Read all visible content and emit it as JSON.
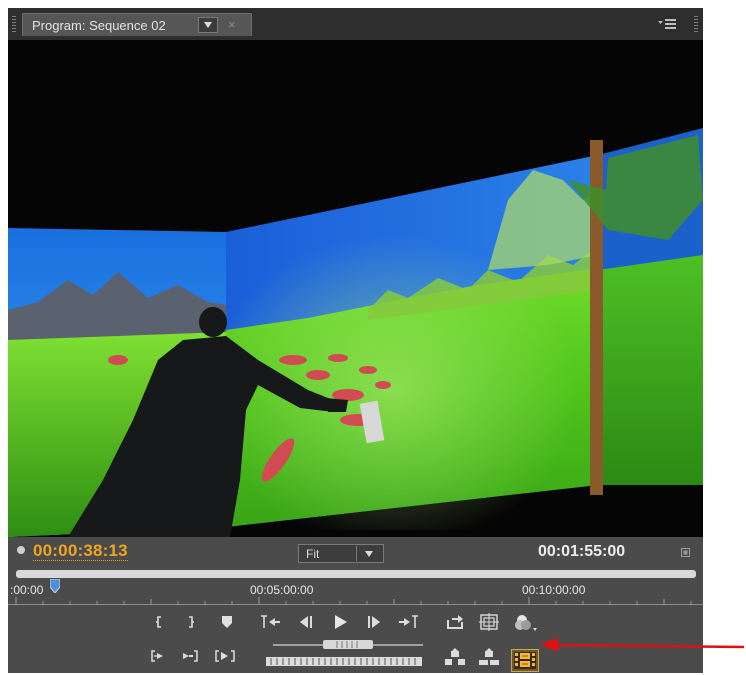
{
  "panel": {
    "tab_title": "Program: Sequence 02",
    "close_glyph": "×"
  },
  "timecode": {
    "current": "00:00:38:13",
    "duration": "00:01:55:00"
  },
  "zoom": {
    "selected": "Fit"
  },
  "ruler": {
    "labels": [
      ":00:00",
      "00:05:00:00",
      "00:10:00:00"
    ]
  },
  "controls": {
    "row1": [
      "mark-in-icon",
      "mark-out-icon",
      "add-marker-icon",
      "go-to-in-icon",
      "step-back-icon",
      "play-icon",
      "step-forward-icon",
      "go-to-out-icon",
      "loop-icon",
      "safe-margins-icon",
      "output-icon"
    ],
    "row2": [
      "play-in-to-out-icon",
      "go-to-previous-edit-icon",
      "go-to-next-edit-icon",
      "lift-icon",
      "extract-icon",
      "export-frame-icon"
    ]
  },
  "colors": {
    "timecode_current": "#f0a51d",
    "panel_bg": "#4b4b4b",
    "tab_bar_bg": "#2e2e2e",
    "annotation_arrow": "#e01010"
  }
}
